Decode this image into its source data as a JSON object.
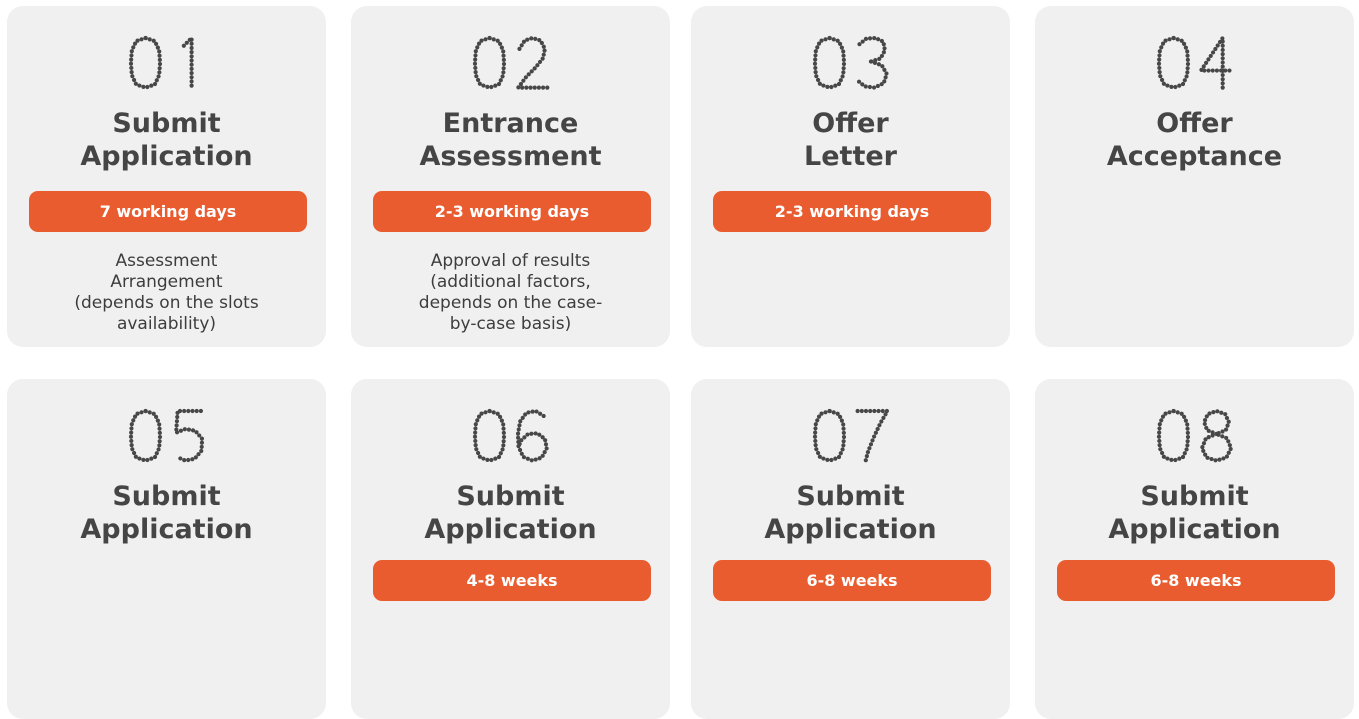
{
  "cards": [
    {
      "number": "01",
      "title_lines": [
        "Submit",
        "Application"
      ],
      "badge": "7 working days",
      "desc_lines": [
        "Assessment",
        "Arrangement",
        "(depends on the slots",
        "availability)"
      ]
    },
    {
      "number": "02",
      "title_lines": [
        "Entrance",
        "Assessment"
      ],
      "badge": "2-3 working days",
      "desc_lines": [
        "Approval of results",
        "(additional factors,",
        "depends on the case-",
        "by-case basis)"
      ]
    },
    {
      "number": "03",
      "title_lines": [
        "Offer",
        "Letter"
      ],
      "badge": "2-3 working days",
      "desc_lines": []
    },
    {
      "number": "04",
      "title_lines": [
        "Offer",
        "Acceptance"
      ],
      "badge": "",
      "desc_lines": []
    },
    {
      "number": "05",
      "title_lines": [
        "Submit",
        "Application"
      ],
      "badge": "",
      "desc_lines": []
    },
    {
      "number": "06",
      "title_lines": [
        "Submit",
        "Application"
      ],
      "badge": "4-8 weeks",
      "desc_lines": []
    },
    {
      "number": "07",
      "title_lines": [
        "Submit",
        "Application"
      ],
      "badge": "6-8 weeks",
      "desc_lines": []
    },
    {
      "number": "08",
      "title_lines": [
        "Submit",
        "Application"
      ],
      "badge": "6-8 weeks",
      "desc_lines": []
    }
  ],
  "colors": {
    "card_bg": "#f0f0f0",
    "badge_bg": "#e85c2f",
    "title_text": "#454545",
    "number_dots": "#474747"
  }
}
